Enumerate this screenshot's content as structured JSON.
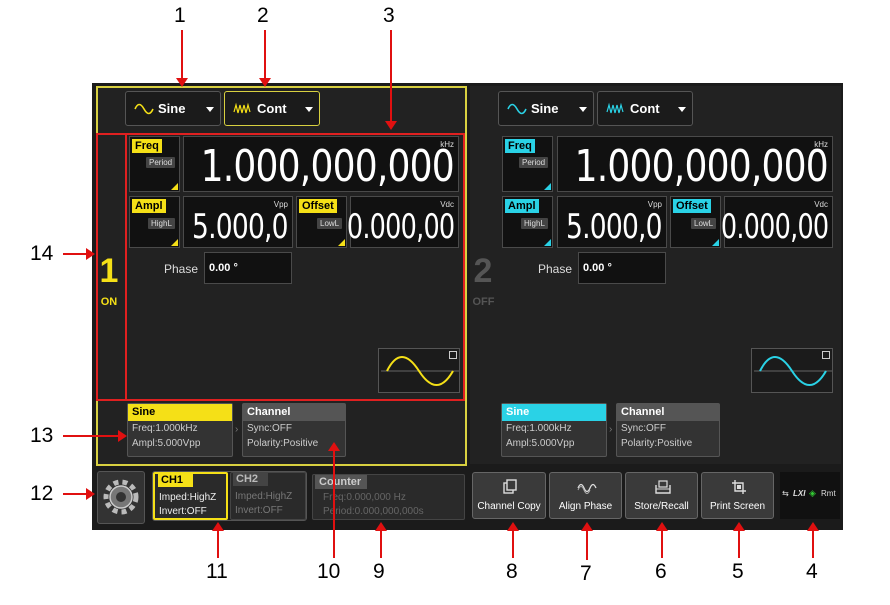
{
  "callouts": [
    "1",
    "2",
    "3",
    "4",
    "5",
    "6",
    "7",
    "8",
    "9",
    "10",
    "11",
    "12",
    "13",
    "14"
  ],
  "colors": {
    "ch1": "#f5e017",
    "ch2": "#2ad2e6",
    "callout_arrow": "#e01010"
  },
  "ch1": {
    "number": "1",
    "state": "ON",
    "waveform": "Sine",
    "mode": "Cont",
    "freq_label": "Freq",
    "freq_alt": "Period",
    "freq_value": "1.000,000,000",
    "freq_unit": "kHz",
    "ampl_label": "Ampl",
    "ampl_alt": "HighL",
    "ampl_value": "5.000,0",
    "ampl_unit": "Vpp",
    "offset_label": "Offset",
    "offset_alt": "LowL",
    "offset_value": "0.000,00",
    "offset_unit": "Vdc",
    "phase_label": "Phase",
    "phase_value": "0.00 °",
    "card1": {
      "title": "Sine",
      "line1": "Freq:1.000kHz",
      "line2": "Ampl:5.000Vpp"
    },
    "card2": {
      "title": "Channel",
      "line1": "Sync:OFF",
      "line2": "Polarity:Positive"
    }
  },
  "ch2": {
    "number": "2",
    "state": "OFF",
    "waveform": "Sine",
    "mode": "Cont",
    "freq_label": "Freq",
    "freq_alt": "Period",
    "freq_value": "1.000,000,000",
    "freq_unit": "kHz",
    "ampl_label": "Ampl",
    "ampl_alt": "HighL",
    "ampl_value": "5.000,0",
    "ampl_unit": "Vpp",
    "offset_label": "Offset",
    "offset_alt": "LowL",
    "offset_value": "0.000,00",
    "offset_unit": "Vdc",
    "phase_label": "Phase",
    "phase_value": "0.00 °",
    "card1": {
      "title": "Sine",
      "line1": "Freq:1.000kHz",
      "line2": "Ampl:5.000Vpp"
    },
    "card2": {
      "title": "Channel",
      "line1": "Sync:OFF",
      "line2": "Polarity:Positive"
    }
  },
  "bottom": {
    "ch1_tab": {
      "title": "CH1",
      "line1": "Imped:HighZ",
      "line2": "Invert:OFF"
    },
    "ch2_tab": {
      "title": "CH2",
      "line1": "Imped:HighZ",
      "line2": "Invert:OFF"
    },
    "counter": {
      "title": "Counter",
      "line1": "Freq:0.000,000 Hz",
      "line2": "Period:0.000,000,000s"
    },
    "buttons": [
      "Channel Copy",
      "Align Phase",
      "Store/Recall",
      "Print Screen"
    ],
    "status_lxi": "LXI",
    "status_rmt": "Rmt"
  }
}
